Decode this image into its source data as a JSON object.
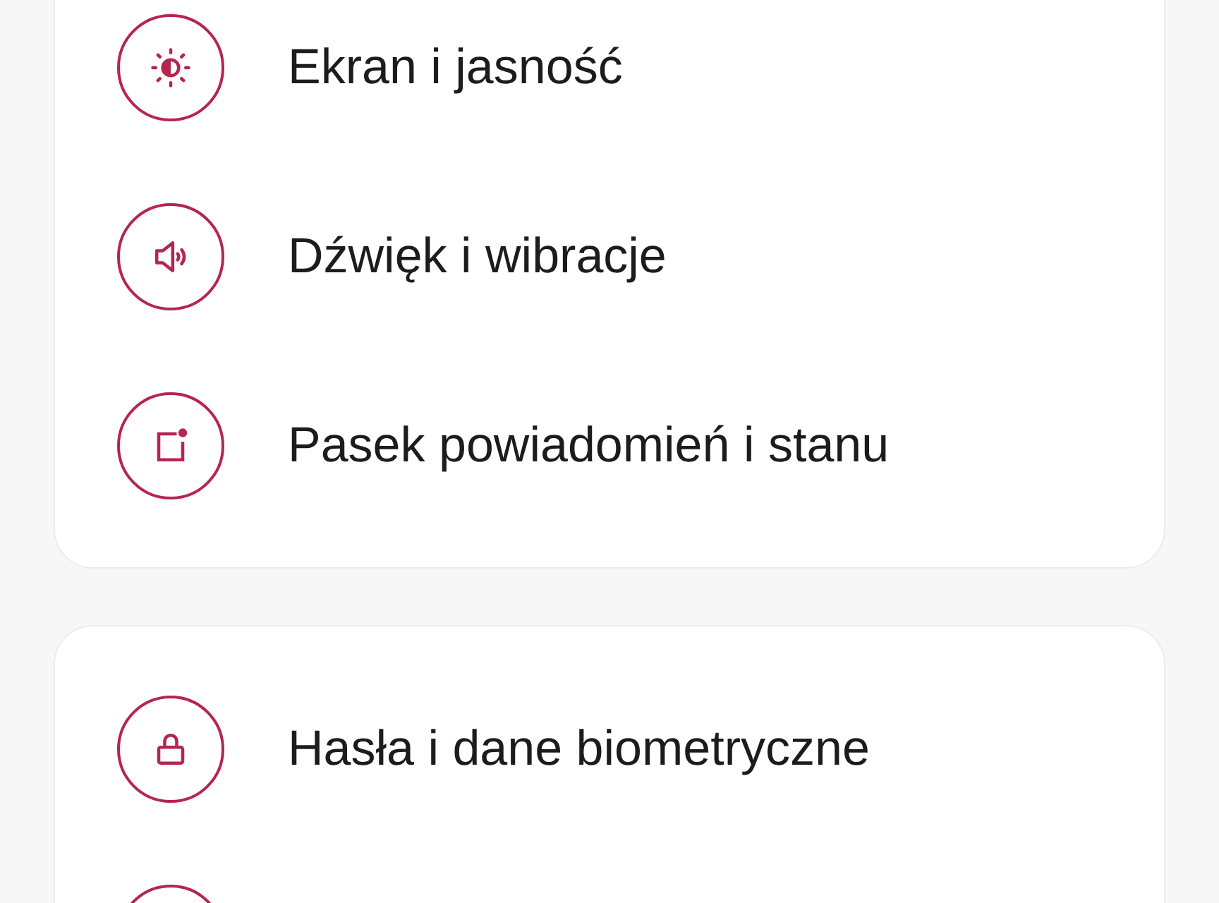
{
  "groups": [
    {
      "items": [
        {
          "kind": "brightness",
          "label": "Ekran i jasność"
        },
        {
          "kind": "sound",
          "label": "Dźwięk i wibracje"
        },
        {
          "kind": "notification",
          "label": "Pasek powiadomień i stanu"
        }
      ]
    },
    {
      "items": [
        {
          "kind": "lock",
          "label": "Hasła i dane biometryczne"
        },
        {
          "kind": "blank"
        }
      ]
    }
  ]
}
